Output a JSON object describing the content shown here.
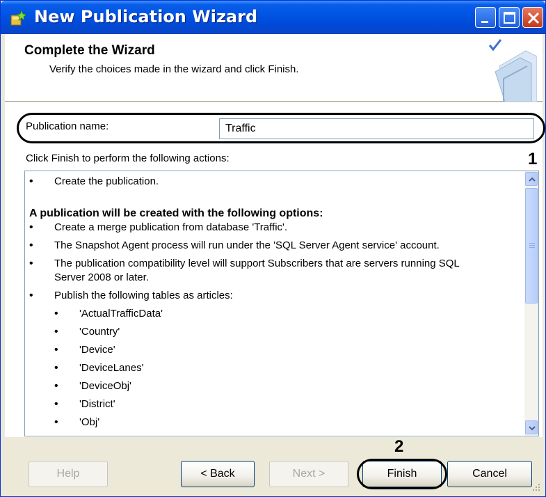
{
  "window": {
    "title": "New Publication Wizard"
  },
  "header": {
    "title": "Complete the Wizard",
    "subtitle": "Verify the choices made in the wizard and click Finish."
  },
  "publication": {
    "label": "Publication name:",
    "value": "Traffic"
  },
  "actions_label": "Click Finish to perform the following actions:",
  "annotations": {
    "one": "1",
    "two": "2"
  },
  "summary": {
    "item1": "Create the publication.",
    "heading": "A publication will be created with the following options:",
    "opt1": "Create a merge publication from database 'Traffic'.",
    "opt2": "The Snapshot Agent process will run under the 'SQL Server Agent service' account.",
    "opt3a": "The publication compatibility level will support Subscribers that are servers running SQL",
    "opt3b": "Server 2008 or later.",
    "opt4": "Publish the following tables as articles:",
    "tables": [
      "'ActualTrafficData'",
      "'Country'",
      "'Device'",
      "'DeviceLanes'",
      "'DeviceObj'",
      "'District'",
      "'Obj'"
    ],
    "bullet": "•"
  },
  "buttons": {
    "help": "Help",
    "back": "< Back",
    "next": "Next >",
    "finish": "Finish",
    "cancel": "Cancel"
  }
}
